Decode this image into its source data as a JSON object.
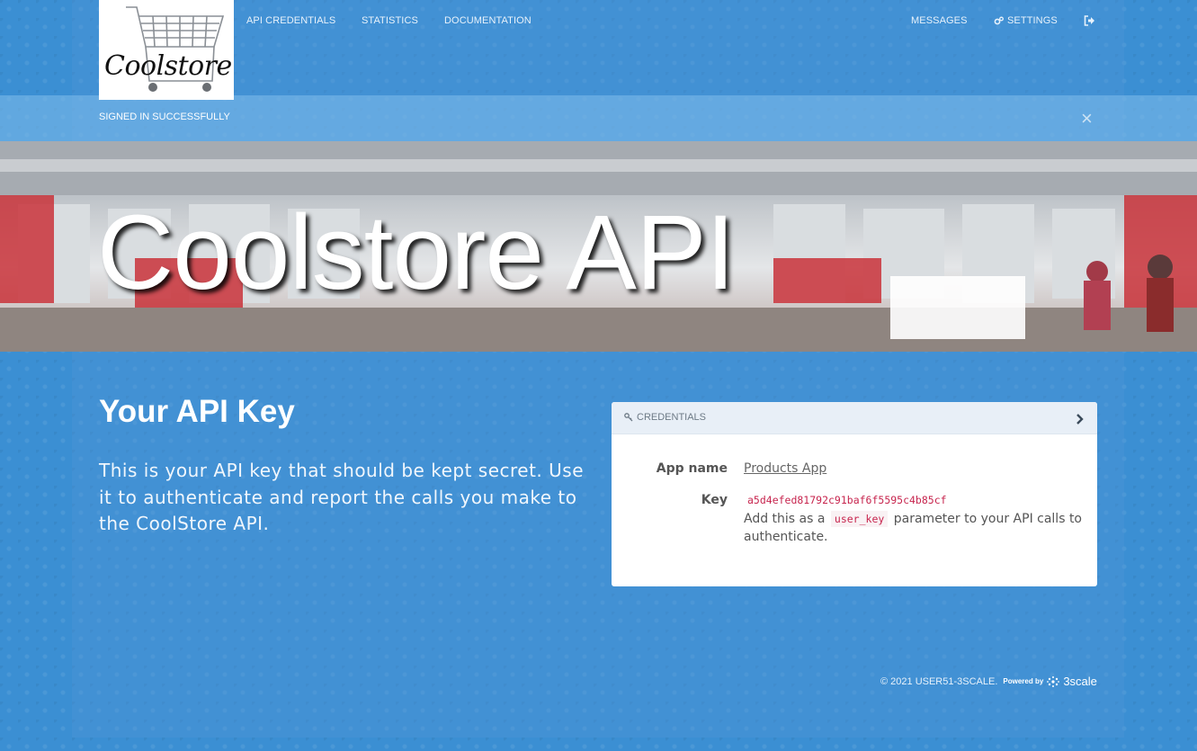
{
  "brand": {
    "logo_text": "Coolstore"
  },
  "nav": {
    "api_credentials": "API CREDENTIALS",
    "statistics": "STATISTICS",
    "documentation": "DOCUMENTATION",
    "messages": "MESSAGES",
    "settings": "SETTINGS"
  },
  "flash": {
    "message": "SIGNED IN SUCCESSFULLY",
    "close": "×"
  },
  "hero": {
    "title": "Coolstore API"
  },
  "main": {
    "heading": "Your API Key",
    "description": "This is your API key that should be kept secret. Use it to authenticate and report the calls you make to the CoolStore API."
  },
  "credentials": {
    "header": "CREDENTIALS",
    "app_name_label": "App name",
    "app_name": "Products App",
    "key_label": "Key",
    "key_value": "a5d4efed81792c91baf6f5595c4b85cf",
    "help_prefix": "Add this as a",
    "help_code": "user_key",
    "help_suffix": "parameter to your API calls to authenticate."
  },
  "footer": {
    "copyright": "© 2021 USER51-3SCALE.",
    "powered_by": "Powered by",
    "powered_brand": "3scale"
  },
  "colors": {
    "background": "#3b8fd3",
    "key_text": "#c7254e"
  }
}
